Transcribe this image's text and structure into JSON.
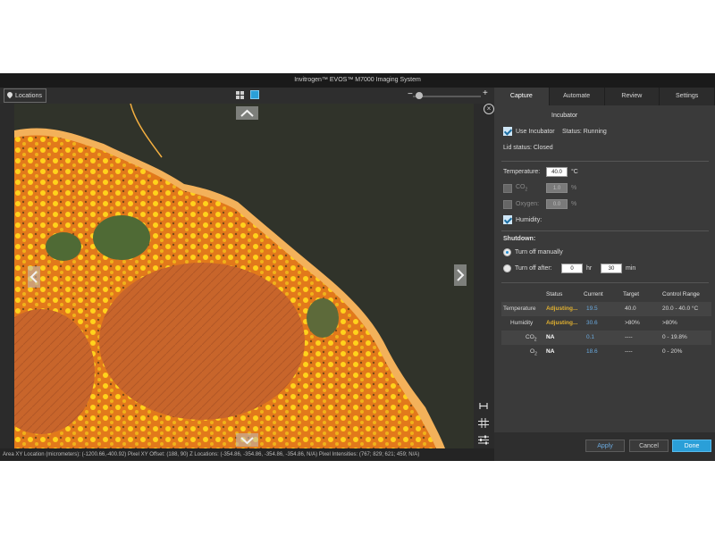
{
  "window": {
    "title": "Invitrogen™ EVOS™ M7000 Imaging System"
  },
  "toolbar": {
    "locations_label": "Locations",
    "zoom_minus": "−",
    "zoom_plus": "+",
    "zoom_level": 0.05
  },
  "viewer": {
    "close_glyph": "×"
  },
  "statusbar": {
    "text": "Area XY Location (micrometers): (-1200.66,-400.92)  Pixel XY Offset: (188, 90)  Z Locations: (-354.86, -354.86, -354.86, -354.86, N/A)  Pixel Intensities: (767; 829; 621; 459; N/A)"
  },
  "panel": {
    "tabs": [
      "Capture",
      "Automate",
      "Review",
      "Settings"
    ],
    "active_tab": 0,
    "incubator": {
      "title": "Incubator",
      "use_incubator_label": "Use Incubator",
      "use_incubator_checked": true,
      "status": "Status: Running",
      "lid_status": "Lid status:  Closed"
    },
    "temperature": {
      "label": "Temperature:",
      "value": "40.0",
      "unit": "°C"
    },
    "co2": {
      "label": "CO",
      "sub": "2",
      "value": "1.0",
      "unit": "%",
      "checked": false
    },
    "oxygen": {
      "label": "Oxygen:",
      "value": "0.0",
      "unit": "%",
      "checked": false
    },
    "humidity": {
      "label": "Humidity:",
      "checked": true
    },
    "shutdown": {
      "title": "Shutdown:",
      "manual_label": "Turn off manually",
      "after_label": "Turn off after:",
      "selected": "manual",
      "hours": "0",
      "hr_label": "hr",
      "minutes": "30",
      "min_label": "min"
    },
    "table": {
      "headers": [
        "Status",
        "Current",
        "Target",
        "Control Range"
      ],
      "rows": [
        {
          "name": "Temperature",
          "status": "Adjusting...",
          "current": "19.5",
          "target": "40.0",
          "range": "20.0 - 40.0 °C"
        },
        {
          "name": "Humidity",
          "status": "Adjusting...",
          "current": "30.6",
          "target": ">80%",
          "range": ">80%"
        },
        {
          "name": "CO",
          "name_sub": "2",
          "status": "NA",
          "current": "0.1",
          "target": "----",
          "range": "0 - 19.8%"
        },
        {
          "name": "O",
          "name_sub": "2",
          "status": "NA",
          "current": "18.6",
          "target": "----",
          "range": "0 - 20%"
        }
      ]
    },
    "buttons": {
      "apply": "Apply",
      "cancel": "Cancel",
      "done": "Done"
    }
  },
  "colors": {
    "accent": "#2a9fd8",
    "adjusting": "#e0b030",
    "current_value": "#6aa9de",
    "tissue_orange": "#e07a1c",
    "tissue_core": "#c4622a",
    "background_green": "#30332a"
  },
  "icons": [
    "location-pin-icon",
    "grid-view-icon",
    "single-view-icon",
    "close-icon",
    "measure-icon",
    "grid-overlay-icon",
    "adjust-sliders-icon",
    "nav-up-arrow-icon",
    "nav-down-arrow-icon",
    "nav-left-arrow-icon",
    "nav-right-arrow-icon"
  ]
}
